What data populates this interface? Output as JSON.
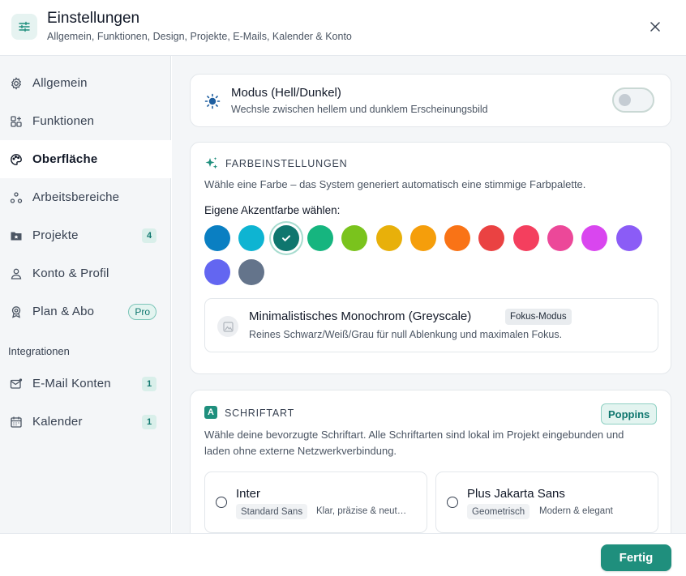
{
  "header": {
    "title": "Einstellungen",
    "subtitle": "Allgemein, Funktionen, Design, Projekte, E-Mails, Kalender & Konto",
    "icon": "sliders-icon",
    "close_icon": "close-icon"
  },
  "sidebar": {
    "items": [
      {
        "label": "Allgemein",
        "icon": "gear-icon",
        "badge": ""
      },
      {
        "label": "Funktionen",
        "icon": "grid-icon",
        "badge": ""
      },
      {
        "label": "Oberfläche",
        "icon": "palette-icon",
        "badge": "",
        "active": true
      },
      {
        "label": "Arbeitsbereiche",
        "icon": "nodes-icon",
        "badge": ""
      },
      {
        "label": "Projekte",
        "icon": "folder-star-icon",
        "badge": "4"
      },
      {
        "label": "Konto & Profil",
        "icon": "user-icon",
        "badge": ""
      },
      {
        "label": "Plan & Abo",
        "icon": "award-icon",
        "badge": "Pro"
      }
    ],
    "section_label": "Integrationen",
    "integrations": [
      {
        "label": "E-Mail Konten",
        "icon": "mail-icon",
        "badge": "1"
      },
      {
        "label": "Kalender",
        "icon": "calendar-icon",
        "badge": "1"
      }
    ]
  },
  "mode": {
    "title": "Modus (Hell/Dunkel)",
    "subtitle": "Wechsle zwischen hellem und dunklem Erscheinungsbild",
    "icon": "sun-icon",
    "dark_enabled": false
  },
  "colors": {
    "heading": "FARBEINSTELLUNGEN",
    "icon": "sparkles-icon",
    "description": "Wähle eine Farbe – das System generiert automatisch eine stimmige Farbpalette.",
    "accent_label": "Eigene Akzentfarbe wählen:",
    "selected_index": 2,
    "swatches": [
      "#0a7fc2",
      "#0eb4d2",
      "#0f766e",
      "#16b57f",
      "#7ac31d",
      "#e8b00a",
      "#f59e0b",
      "#f97316",
      "#ea4242",
      "#f43f5e",
      "#ec4899",
      "#d946ef",
      "#8b5cf6",
      "#6366f1",
      "#64748b"
    ],
    "monochrome": {
      "title": "Minimalistisches Monochrom (Greyscale)",
      "tag": "Fokus-Modus",
      "subtitle": "Reines Schwarz/Weiß/Grau für null Ablenkung und maximalen Fokus.",
      "icon": "image-icon"
    }
  },
  "font": {
    "heading": "SCHRIFTART",
    "icon": "font-icon",
    "current": "Poppins",
    "description": "Wähle deine bevorzugte Schriftart. Alle Schriftarten sind lokal im Projekt eingebunden und laden ohne externe Netzwerkverbindung.",
    "options": [
      {
        "name": "Inter",
        "tag": "Standard Sans",
        "meta": "Klar, präzise & neut…"
      },
      {
        "name": "Plus Jakarta Sans",
        "tag": "Geometrisch",
        "meta": "Modern & elegant"
      }
    ]
  },
  "footer": {
    "done_label": "Fertig"
  },
  "theme": {
    "accent": "#1f8f7d",
    "accent_light": "#e3f4f0"
  }
}
